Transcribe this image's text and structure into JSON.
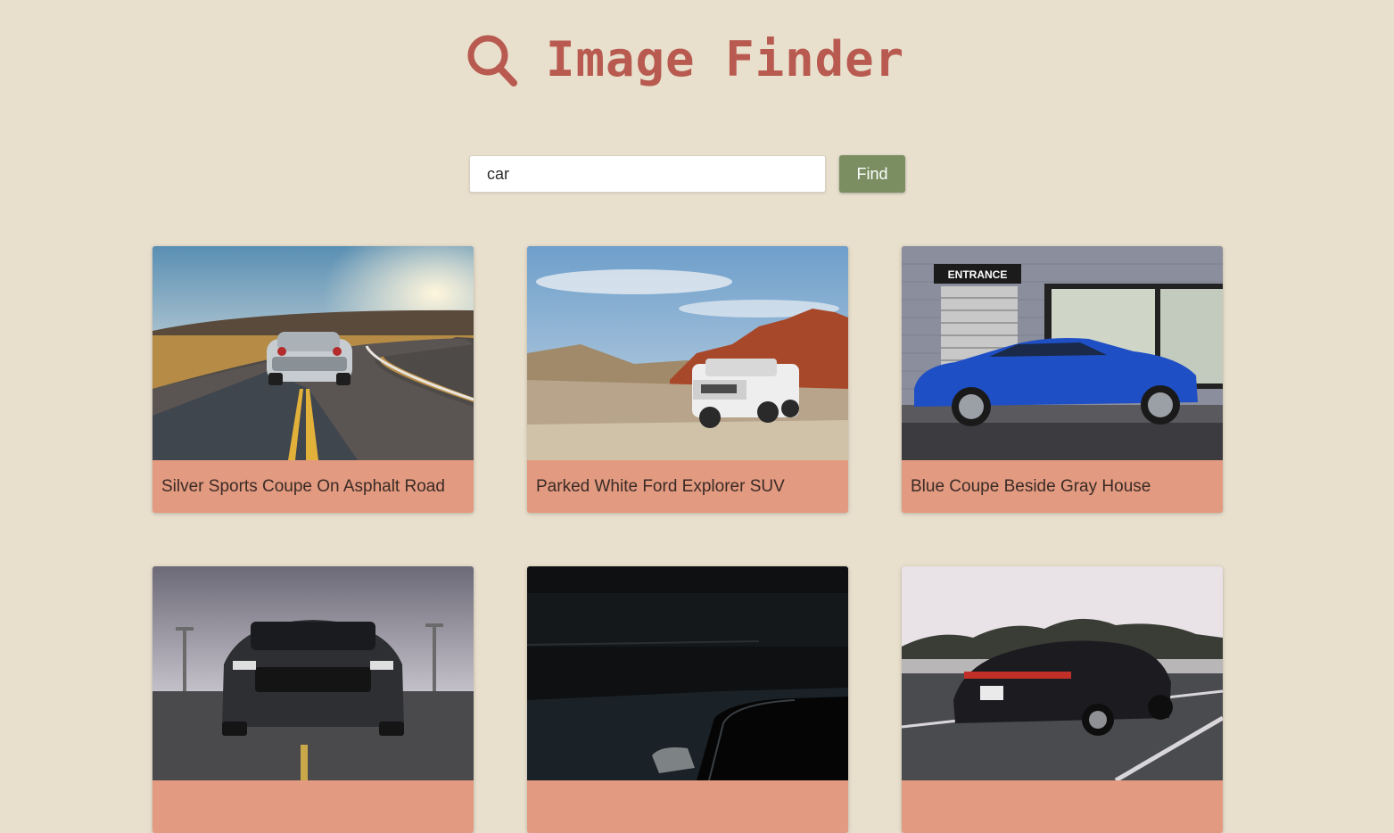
{
  "header": {
    "icon": "magnifier-icon",
    "title": "Image Finder",
    "accent_color": "#b85a4f"
  },
  "search": {
    "value": "car",
    "button_label": "Find",
    "button_color": "#7a8e62"
  },
  "results": [
    {
      "caption": "Silver Sports Coupe On Asphalt Road"
    },
    {
      "caption": "Parked White Ford Explorer SUV"
    },
    {
      "caption": "Blue Coupe Beside Gray House"
    },
    {
      "caption": ""
    },
    {
      "caption": ""
    },
    {
      "caption": ""
    }
  ],
  "photo_text": {
    "entrance_sign": "ENTRANCE"
  },
  "colors": {
    "background": "#e8dfcd",
    "caption_bar": "#e29a80"
  }
}
